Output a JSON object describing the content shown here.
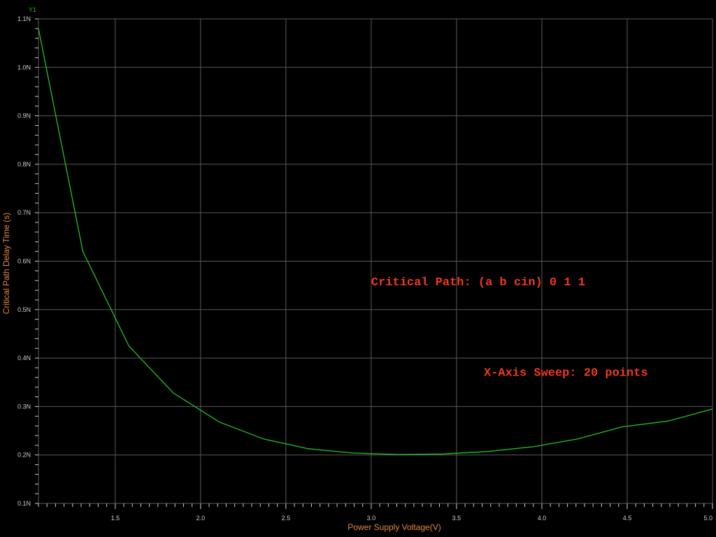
{
  "colors": {
    "background": "#000000",
    "grid": "#5a5a5a",
    "series": "#22c422",
    "axis_title": "#e08a3c",
    "annotation": "#f03a1e",
    "tick_label": "#cfcfcf"
  },
  "chart_data": {
    "type": "line",
    "xlabel": "Power Supply Voltage(V)",
    "ylabel": "Critical Path Delay Time (s)",
    "xlim": [
      1.05,
      5.0
    ],
    "ylim": [
      0.1,
      1.1
    ],
    "grid": true,
    "x_ticks": [
      1.5,
      2.0,
      2.5,
      3.0,
      3.5,
      4.0,
      4.5,
      5.0
    ],
    "x_tick_labels": [
      "1.5",
      "2.0",
      "2.5",
      "3.0",
      "3.5",
      "4.0",
      "4.5",
      "5.0"
    ],
    "y_ticks": [
      0.1,
      0.2,
      0.3,
      0.4,
      0.5,
      0.6,
      0.7,
      0.8,
      0.9,
      1.0,
      1.1
    ],
    "y_tick_labels": [
      "0.1N",
      "0.2N",
      "0.3N",
      "0.4N",
      "0.5N",
      "0.6N",
      "0.7N",
      "0.8N",
      "0.9N",
      "1.0N",
      "1.1N"
    ],
    "series": [
      {
        "name": "Y1",
        "color": "#22c422",
        "x": [
          1.05,
          1.31,
          1.58,
          1.84,
          2.11,
          2.37,
          2.63,
          2.89,
          3.16,
          3.42,
          3.68,
          3.95,
          4.21,
          4.47,
          4.74,
          5.0
        ],
        "y": [
          1.08,
          0.62,
          0.425,
          0.328,
          0.268,
          0.233,
          0.213,
          0.204,
          0.201,
          0.202,
          0.207,
          0.217,
          0.233,
          0.258,
          0.27,
          0.295
        ]
      }
    ],
    "annotations": [
      {
        "text": "Critical Path: (a b cin) 0 1 1",
        "x": 3.0,
        "y": 0.55
      },
      {
        "text": "X-Axis Sweep: 20 points",
        "x": 3.66,
        "y": 0.363
      }
    ]
  }
}
